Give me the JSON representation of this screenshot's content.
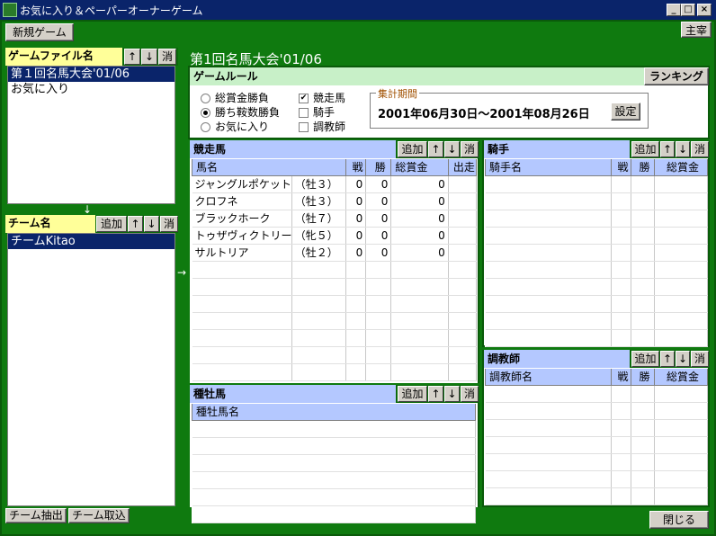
{
  "window": {
    "title": "お気に入り＆ペーパーオーナーゲーム",
    "minimize": "_",
    "maximize": "□",
    "close": "×"
  },
  "toolbar": {
    "new_game": "新規ゲーム",
    "host": "主宰"
  },
  "game_files": {
    "header": "ゲームファイル名",
    "up": "↑",
    "down": "↓",
    "del": "消",
    "items": [
      {
        "label": "第１回名馬大会'01/06",
        "selected": true
      },
      {
        "label": "お気に入り",
        "selected": false
      }
    ]
  },
  "teams": {
    "header": "チーム名",
    "add": "追加",
    "up": "↑",
    "down": "↓",
    "del": "消",
    "items": [
      {
        "label": "チームKitao",
        "selected": true
      }
    ]
  },
  "arrows": {
    "down": "↓",
    "right": "→"
  },
  "bottom": {
    "extract": "チーム抽出",
    "import": "チーム取込",
    "close": "閉じる"
  },
  "game": {
    "title": "第1回名馬大会'01/06"
  },
  "rules": {
    "header": "ゲームルール",
    "ranking": "ランキング",
    "radios": [
      {
        "label": "総賞金勝負",
        "checked": false
      },
      {
        "label": "勝ち鞍数勝負",
        "checked": true
      },
      {
        "label": "お気に入り",
        "checked": false
      }
    ],
    "checks": [
      {
        "label": "競走馬",
        "checked": true
      },
      {
        "label": "騎手",
        "checked": false
      },
      {
        "label": "調教師",
        "checked": false
      }
    ],
    "period_label": "集計期間",
    "period_value": "2001年06月30日～2001年08月26日",
    "set": "設定"
  },
  "horses": {
    "header": "競走馬",
    "add": "追加",
    "up": "↑",
    "down": "↓",
    "del": "消",
    "columns": [
      "馬名",
      "戦",
      "勝",
      "総賞金",
      "出走"
    ],
    "rows": [
      [
        "ジャングルポケット",
        "（牡３）",
        "0",
        "0",
        "0",
        ""
      ],
      [
        "クロフネ",
        "（牡３）",
        "0",
        "0",
        "0",
        ""
      ],
      [
        "ブラックホーク",
        "（牡７）",
        "0",
        "0",
        "0",
        ""
      ],
      [
        "トゥザヴィクトリー",
        "（牝５）",
        "0",
        "0",
        "0",
        ""
      ],
      [
        "サルトリア",
        "（牡２）",
        "0",
        "0",
        "0",
        ""
      ]
    ]
  },
  "jockeys": {
    "header": "騎手",
    "add": "追加",
    "up": "↑",
    "down": "↓",
    "del": "消",
    "columns": [
      "騎手名",
      "戦",
      "勝",
      "総賞金"
    ]
  },
  "trainers": {
    "header": "調教師",
    "add": "追加",
    "up": "↑",
    "down": "↓",
    "del": "消",
    "columns": [
      "調教師名",
      "戦",
      "勝",
      "総賞金"
    ]
  },
  "sires": {
    "header": "種牡馬",
    "add": "追加",
    "up": "↑",
    "down": "↓",
    "del": "消",
    "columns": [
      "種牡馬名"
    ]
  }
}
